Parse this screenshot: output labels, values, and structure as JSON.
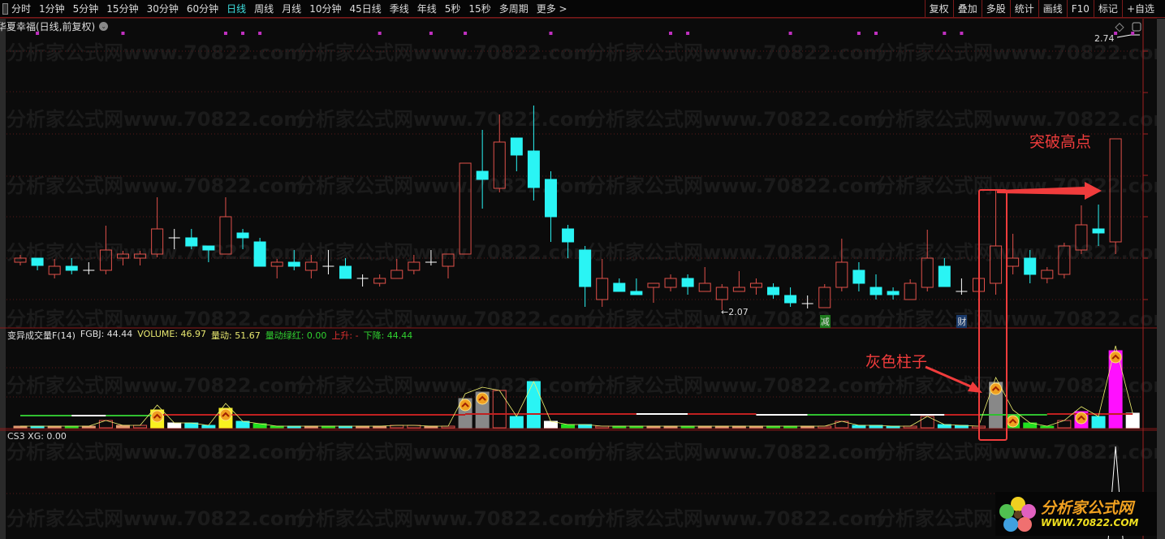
{
  "toolbar": {
    "periods": [
      "分时",
      "1分钟",
      "5分钟",
      "15分钟",
      "30分钟",
      "60分钟",
      "日线",
      "周线",
      "月线",
      "10分钟",
      "45日线",
      "季线",
      "年线",
      "5秒",
      "15秒",
      "多周期",
      "更多 >"
    ],
    "active_period": "日线",
    "right_tools": [
      "复权",
      "叠加",
      "多股",
      "统计",
      "画线",
      "F10",
      "标记",
      "+自选"
    ]
  },
  "chart_title": "华夏幸福(日线,前复权)",
  "price_labels": {
    "high": "2.74",
    "low": "←2.07"
  },
  "badges": [
    {
      "text": "减",
      "candle": 48,
      "color": "#1e7a1e"
    },
    {
      "text": "财",
      "candle": 56,
      "color": "#1a3a6a"
    }
  ],
  "volume_indicator": {
    "name": "变异成交量F(14)",
    "items": [
      {
        "label": "FGBJ: 44.44",
        "color": "#e0e0e0"
      },
      {
        "label": "VOLUME: 46.97",
        "color": "#e8e870"
      },
      {
        "label": "量动: 51.67",
        "color": "#e8e870"
      },
      {
        "label": "量动绿红: 0.00",
        "color": "#30d030"
      },
      {
        "label": "上升: -",
        "color": "#e03030"
      },
      {
        "label": "下降: 44.44",
        "color": "#30d030"
      }
    ]
  },
  "cs3_indicator": {
    "label": "CS3 XG: 0.00"
  },
  "annotations": {
    "breakout": "突破高点",
    "gray_bar": "灰色柱子"
  },
  "watermark": "分析家公式网www.70822.com",
  "logo": {
    "name": "分析家公式网",
    "url": "WWW.70822.COM"
  },
  "colors": {
    "up": "#e0504a",
    "down": "#2af4f4",
    "doji": "#ffffff",
    "grid": "#5a1a1a"
  },
  "chart_data": {
    "type": "candlestick",
    "candles": [
      [
        2.188,
        2.198,
        2.206,
        2.18
      ],
      [
        2.198,
        2.18,
        2.198,
        2.168
      ],
      [
        2.158,
        2.178,
        2.196,
        2.148
      ],
      [
        2.178,
        2.168,
        2.198,
        2.158
      ],
      [
        2.168,
        2.168,
        2.188,
        2.158
      ],
      [
        2.168,
        2.218,
        2.278,
        2.158
      ],
      [
        2.198,
        2.208,
        2.216,
        2.18
      ],
      [
        2.198,
        2.208,
        2.216,
        2.18
      ],
      [
        2.208,
        2.27,
        2.348,
        2.2
      ],
      [
        2.248,
        2.248,
        2.27,
        2.22
      ],
      [
        2.248,
        2.228,
        2.27,
        2.22
      ],
      [
        2.228,
        2.218,
        2.228,
        2.188
      ],
      [
        2.208,
        2.3,
        2.348,
        2.208
      ],
      [
        2.26,
        2.248,
        2.27,
        2.22
      ],
      [
        2.238,
        2.178,
        2.248,
        2.178
      ],
      [
        2.178,
        2.188,
        2.196,
        2.148
      ],
      [
        2.188,
        2.178,
        2.218,
        2.168
      ],
      [
        2.168,
        2.188,
        2.206,
        2.148
      ],
      [
        2.178,
        2.178,
        2.218,
        2.158
      ],
      [
        2.178,
        2.148,
        2.198,
        2.148
      ],
      [
        2.148,
        2.148,
        2.158,
        2.128
      ],
      [
        2.136,
        2.148,
        2.158,
        2.128
      ],
      [
        2.148,
        2.168,
        2.196,
        2.148
      ],
      [
        2.168,
        2.188,
        2.206,
        2.158
      ],
      [
        2.188,
        2.188,
        2.218,
        2.18
      ],
      [
        2.178,
        2.208,
        2.208,
        2.148
      ],
      [
        2.208,
        2.432,
        2.432,
        2.208
      ],
      [
        2.412,
        2.392,
        2.514,
        2.32
      ],
      [
        2.37,
        2.484,
        2.552,
        2.36
      ],
      [
        2.494,
        2.452,
        2.494,
        2.412
      ],
      [
        2.462,
        2.372,
        2.574,
        2.34
      ],
      [
        2.392,
        2.3,
        2.412,
        2.238
      ],
      [
        2.27,
        2.238,
        2.28,
        2.198
      ],
      [
        2.218,
        2.128,
        2.228,
        2.078
      ],
      [
        2.096,
        2.148,
        2.196,
        2.078
      ],
      [
        2.136,
        2.116,
        2.148,
        2.116
      ],
      [
        2.116,
        2.108,
        2.148,
        2.108
      ],
      [
        2.126,
        2.136,
        2.136,
        2.088
      ],
      [
        2.126,
        2.148,
        2.158,
        2.116
      ],
      [
        2.148,
        2.128,
        2.158,
        2.108
      ],
      [
        2.116,
        2.136,
        2.176,
        2.116
      ],
      [
        2.096,
        2.126,
        2.134,
        2.07
      ],
      [
        2.116,
        2.126,
        2.166,
        2.116
      ],
      [
        2.126,
        2.136,
        2.148,
        2.108
      ],
      [
        2.126,
        2.108,
        2.136,
        2.098
      ],
      [
        2.106,
        2.088,
        2.126,
        2.078
      ],
      [
        2.086,
        2.086,
        2.106,
        2.074
      ],
      [
        2.076,
        2.126,
        2.134,
        2.076
      ],
      [
        2.126,
        2.188,
        2.246,
        2.116
      ],
      [
        2.168,
        2.136,
        2.188,
        2.116
      ],
      [
        2.126,
        2.108,
        2.158,
        2.096
      ],
      [
        2.116,
        2.108,
        2.126,
        2.096
      ],
      [
        2.096,
        2.136,
        2.146,
        2.096
      ],
      [
        2.126,
        2.198,
        2.268,
        2.116
      ],
      [
        2.178,
        2.128,
        2.198,
        2.128
      ],
      [
        2.116,
        2.116,
        2.148,
        2.108
      ],
      [
        2.116,
        2.148,
        2.148,
        2.116
      ],
      [
        2.136,
        2.228,
        2.368,
        2.108
      ],
      [
        2.178,
        2.198,
        2.258,
        2.158
      ],
      [
        2.198,
        2.158,
        2.218,
        2.136
      ],
      [
        2.148,
        2.168,
        2.176,
        2.136
      ],
      [
        2.158,
        2.228,
        2.236,
        2.148
      ],
      [
        2.218,
        2.28,
        2.328,
        2.208
      ],
      [
        2.27,
        2.26,
        2.33,
        2.228
      ],
      [
        2.238,
        2.492,
        2.492,
        2.208
      ]
    ],
    "event_markers": [
      2,
      7,
      13,
      14,
      15,
      22,
      25,
      27,
      32,
      39,
      40,
      46,
      50,
      51,
      55,
      56,
      65,
      66
    ],
    "volume": [
      [
        2,
        "o"
      ],
      [
        2,
        "c"
      ],
      [
        2,
        "o"
      ],
      [
        2,
        "g"
      ],
      [
        2,
        "o"
      ],
      [
        9,
        "r"
      ],
      [
        3,
        "o"
      ],
      [
        3,
        "r"
      ],
      [
        22,
        "y",
        1
      ],
      [
        6,
        "w"
      ],
      [
        6,
        "c"
      ],
      [
        3,
        "c"
      ],
      [
        24,
        "y",
        1
      ],
      [
        8,
        "c"
      ],
      [
        5,
        "g"
      ],
      [
        2,
        "g"
      ],
      [
        2,
        "c"
      ],
      [
        2,
        "o"
      ],
      [
        2,
        "g"
      ],
      [
        2,
        "c"
      ],
      [
        2,
        "o"
      ],
      [
        2,
        "o"
      ],
      [
        3,
        "r"
      ],
      [
        3,
        "r"
      ],
      [
        2,
        "o"
      ],
      [
        2,
        "r"
      ],
      [
        36,
        "gray",
        1
      ],
      [
        44,
        "gray",
        1
      ],
      [
        46,
        "r"
      ],
      [
        14,
        "c"
      ],
      [
        57,
        "c"
      ],
      [
        8,
        "w"
      ],
      [
        4,
        "g"
      ],
      [
        4,
        "c"
      ],
      [
        2,
        "r"
      ],
      [
        2,
        "g"
      ],
      [
        2,
        "g"
      ],
      [
        2,
        "o"
      ],
      [
        2,
        "o"
      ],
      [
        2,
        "g"
      ],
      [
        2,
        "o"
      ],
      [
        2,
        "o"
      ],
      [
        2,
        "o"
      ],
      [
        2,
        "o"
      ],
      [
        2,
        "g"
      ],
      [
        2,
        "g"
      ],
      [
        2,
        "o"
      ],
      [
        2,
        "r"
      ],
      [
        8,
        "r"
      ],
      [
        3,
        "c"
      ],
      [
        3,
        "c"
      ],
      [
        2,
        "c"
      ],
      [
        2,
        "r"
      ],
      [
        14,
        "r"
      ],
      [
        4,
        "c"
      ],
      [
        3,
        "c"
      ],
      [
        2,
        "r"
      ],
      [
        56,
        "gray",
        1
      ],
      [
        16,
        "g",
        1
      ],
      [
        6,
        "g"
      ],
      [
        2,
        "g"
      ],
      [
        9,
        "r"
      ],
      [
        20,
        "m",
        1
      ],
      [
        14,
        "c"
      ],
      [
        95,
        "m",
        1
      ],
      [
        18,
        "w"
      ]
    ],
    "ma_segments": [
      [
        1,
        4,
        15,
        "#30c030"
      ],
      [
        4,
        6,
        15,
        "#ffffff"
      ],
      [
        6,
        9,
        15,
        "#30c030"
      ],
      [
        9,
        27,
        16,
        "#c02020"
      ],
      [
        27,
        37,
        17,
        "#c02020"
      ],
      [
        37,
        40,
        17,
        "#ffffff"
      ],
      [
        40,
        44,
        17,
        "#c02020"
      ],
      [
        44,
        47,
        16,
        "#ffffff"
      ],
      [
        47,
        53,
        16,
        "#30c030"
      ],
      [
        53,
        55,
        16,
        "#ffffff"
      ],
      [
        55,
        57,
        16,
        "#c02020"
      ],
      [
        57,
        61,
        16,
        "#30c030"
      ],
      [
        61,
        66,
        17,
        "#c02020"
      ]
    ],
    "cs3_signal_candle": 65,
    "price_range": [
      2.07,
      2.74
    ]
  }
}
